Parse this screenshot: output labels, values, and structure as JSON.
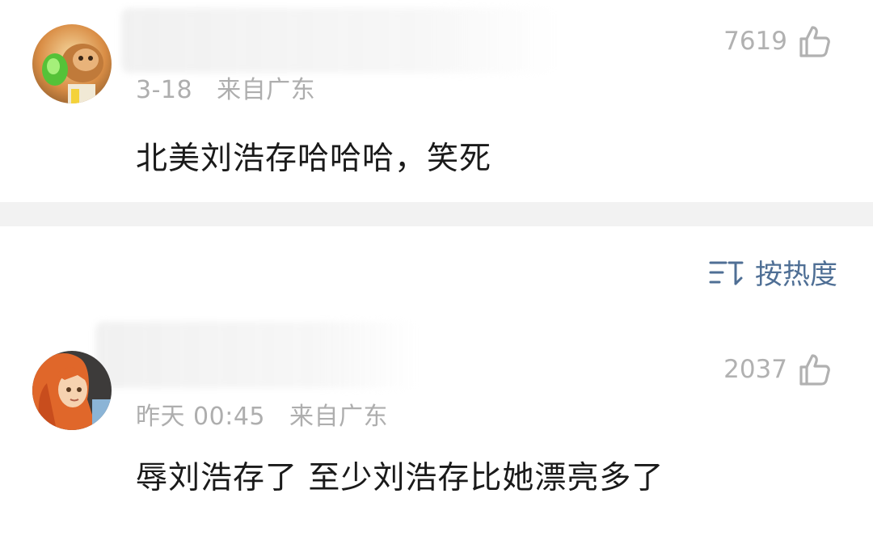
{
  "comments": [
    {
      "date": "3-18",
      "location": "来自广东",
      "likes": "7619",
      "text": "北美刘浩存哈哈哈，笑死"
    },
    {
      "date": "昨天 00:45",
      "location": "来自广东",
      "likes": "2037",
      "text": "辱刘浩存了 至少刘浩存比她漂亮多了"
    }
  ],
  "sort": {
    "label": "按热度",
    "icon": "sort-icon"
  },
  "icons": {
    "like": "thumbs-up-icon"
  },
  "colors": {
    "meta_gray": "#aeaeae",
    "text_dark": "#1a1a1a",
    "link_blue": "#4f6f95",
    "divider": "#f2f2f2"
  }
}
